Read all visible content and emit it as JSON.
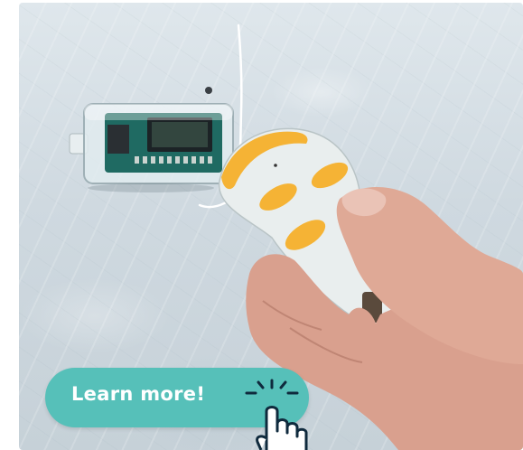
{
  "cta": {
    "label": "Learn more!",
    "background_color": "#56c0b9",
    "text_color": "#ffffff"
  },
  "icons": {
    "cta_icon": "hand-pointer-click-icon"
  },
  "colors": {
    "accent": "#56c0b9",
    "remote_buttons": "#f5b335",
    "wall": "#d4dde3"
  }
}
